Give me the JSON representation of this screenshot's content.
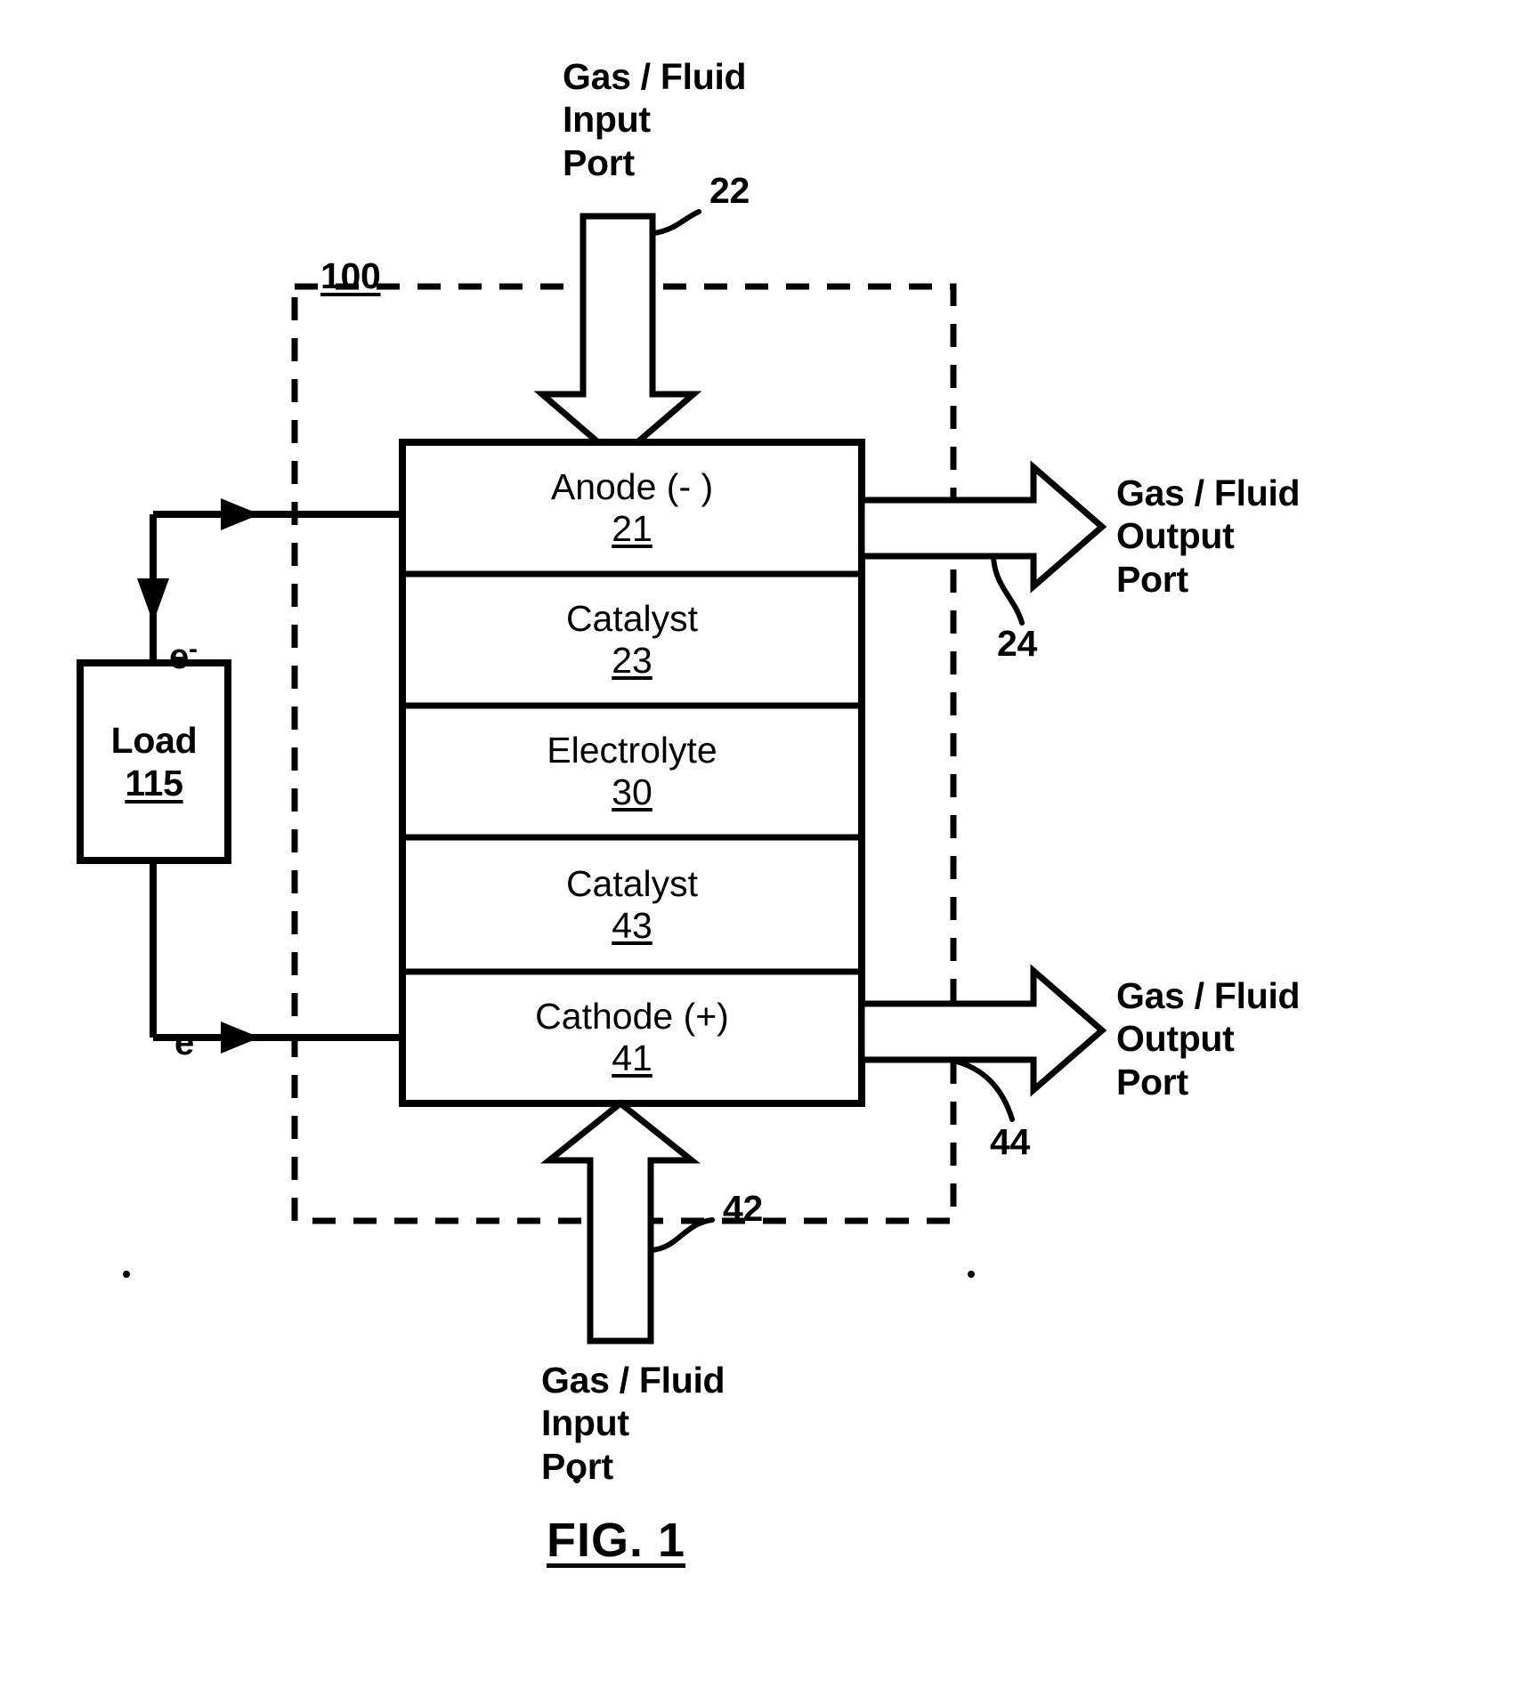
{
  "figure": {
    "caption": "FIG. 1",
    "assembly_ref": "100"
  },
  "ports": {
    "top_input": "Gas / Fluid\nInput\nPort",
    "top_input_ref": "22",
    "upper_output": "Gas / Fluid\nOutput\nPort",
    "upper_output_ref": "24",
    "lower_output": "Gas / Fluid\nOutput\nPort",
    "lower_output_ref": "44",
    "bottom_input": "Gas / Fluid\nInput\nPort",
    "bottom_input_ref": "42"
  },
  "stack": {
    "layers": [
      {
        "title": "Anode (- )",
        "ref": "21"
      },
      {
        "title": "Catalyst",
        "ref": "23"
      },
      {
        "title": "Electrolyte",
        "ref": "30"
      },
      {
        "title": "Catalyst",
        "ref": "43"
      },
      {
        "title": "Cathode (+)",
        "ref": "41"
      }
    ]
  },
  "circuit": {
    "load_title": "Load",
    "load_ref": "115",
    "electron_top": "e",
    "electron_top_sup": "-",
    "electron_bottom": "e",
    "electron_bottom_sup": "-"
  }
}
